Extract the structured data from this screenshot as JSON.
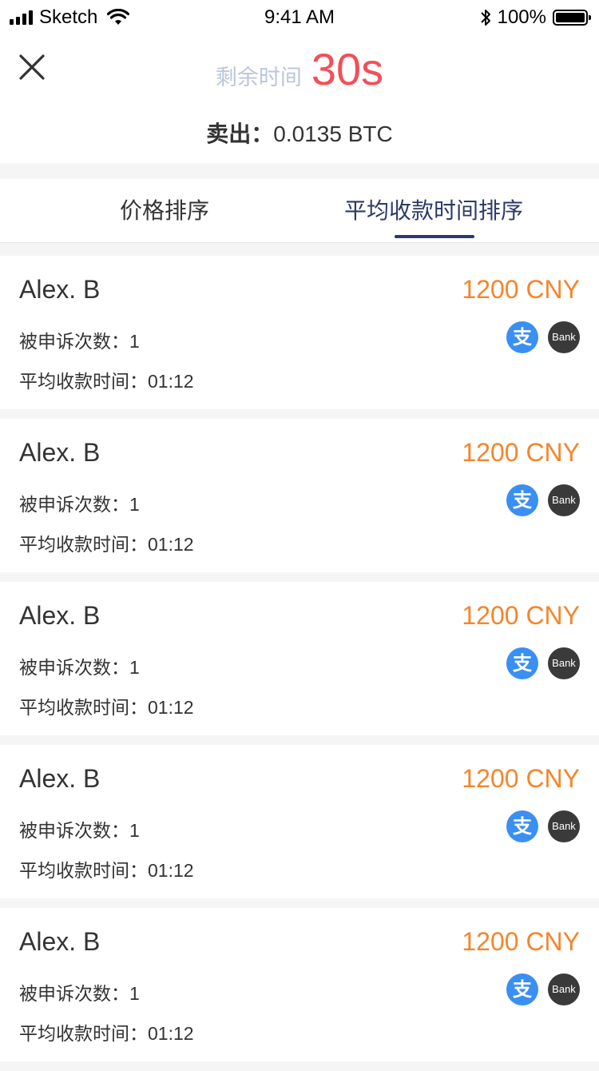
{
  "status_bar": {
    "carrier": "Sketch",
    "time": "9:41 AM",
    "battery_percent": "100%",
    "battery_level": 1.0,
    "icons": [
      "signal-icon",
      "wifi-icon",
      "bluetooth-icon",
      "battery-icon"
    ]
  },
  "header": {
    "close_icon": "close-icon",
    "timer_label": "剩余时间",
    "timer_value": "30s",
    "sell_label": "卖出：",
    "sell_amount": "0.0135 BTC"
  },
  "tabs": [
    {
      "label": "价格排序",
      "active": false
    },
    {
      "label": "平均收款时间排序",
      "active": true
    }
  ],
  "colors": {
    "accent_price": "#f5852b",
    "timer": "#f0505a",
    "active_tab": "#2c3a66",
    "alipay": "#3a8ff2",
    "bank": "#3a3a3a"
  },
  "offers": [
    {
      "name": "Alex. B",
      "price": "1200 CNY",
      "complaints": "被申诉次数：1",
      "avg_time": "平均收款时间：01:12",
      "alipay_glyph": "支",
      "bank_label": "Bank"
    },
    {
      "name": "Alex. B",
      "price": "1200 CNY",
      "complaints": "被申诉次数：1",
      "avg_time": "平均收款时间：01:12",
      "alipay_glyph": "支",
      "bank_label": "Bank"
    },
    {
      "name": "Alex. B",
      "price": "1200 CNY",
      "complaints": "被申诉次数：1",
      "avg_time": "平均收款时间：01:12",
      "alipay_glyph": "支",
      "bank_label": "Bank"
    },
    {
      "name": "Alex. B",
      "price": "1200 CNY",
      "complaints": "被申诉次数：1",
      "avg_time": "平均收款时间：01:12",
      "alipay_glyph": "支",
      "bank_label": "Bank"
    },
    {
      "name": "Alex. B",
      "price": "1200 CNY",
      "complaints": "被申诉次数：1",
      "avg_time": "平均收款时间：01:12",
      "alipay_glyph": "支",
      "bank_label": "Bank"
    }
  ]
}
